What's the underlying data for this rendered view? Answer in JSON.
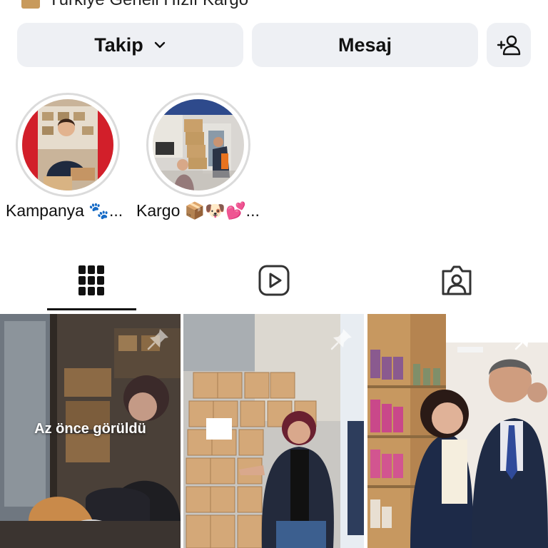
{
  "bio": {
    "line": "Türkiye Geneli Hızlı Kargo"
  },
  "actions": {
    "follow_label": "Takip",
    "message_label": "Mesaj"
  },
  "highlights": [
    {
      "label": "Kampanya 🐾..."
    },
    {
      "label": "Kargo 📦🐶💕..."
    }
  ],
  "tabs": [
    "grid-tab",
    "reels-tab",
    "tagged-tab"
  ],
  "posts": [
    {
      "overlay": "Az önce görüldü",
      "pinned": true
    },
    {
      "overlay": "",
      "pinned": true
    },
    {
      "overlay": "",
      "pinned": true
    }
  ]
}
